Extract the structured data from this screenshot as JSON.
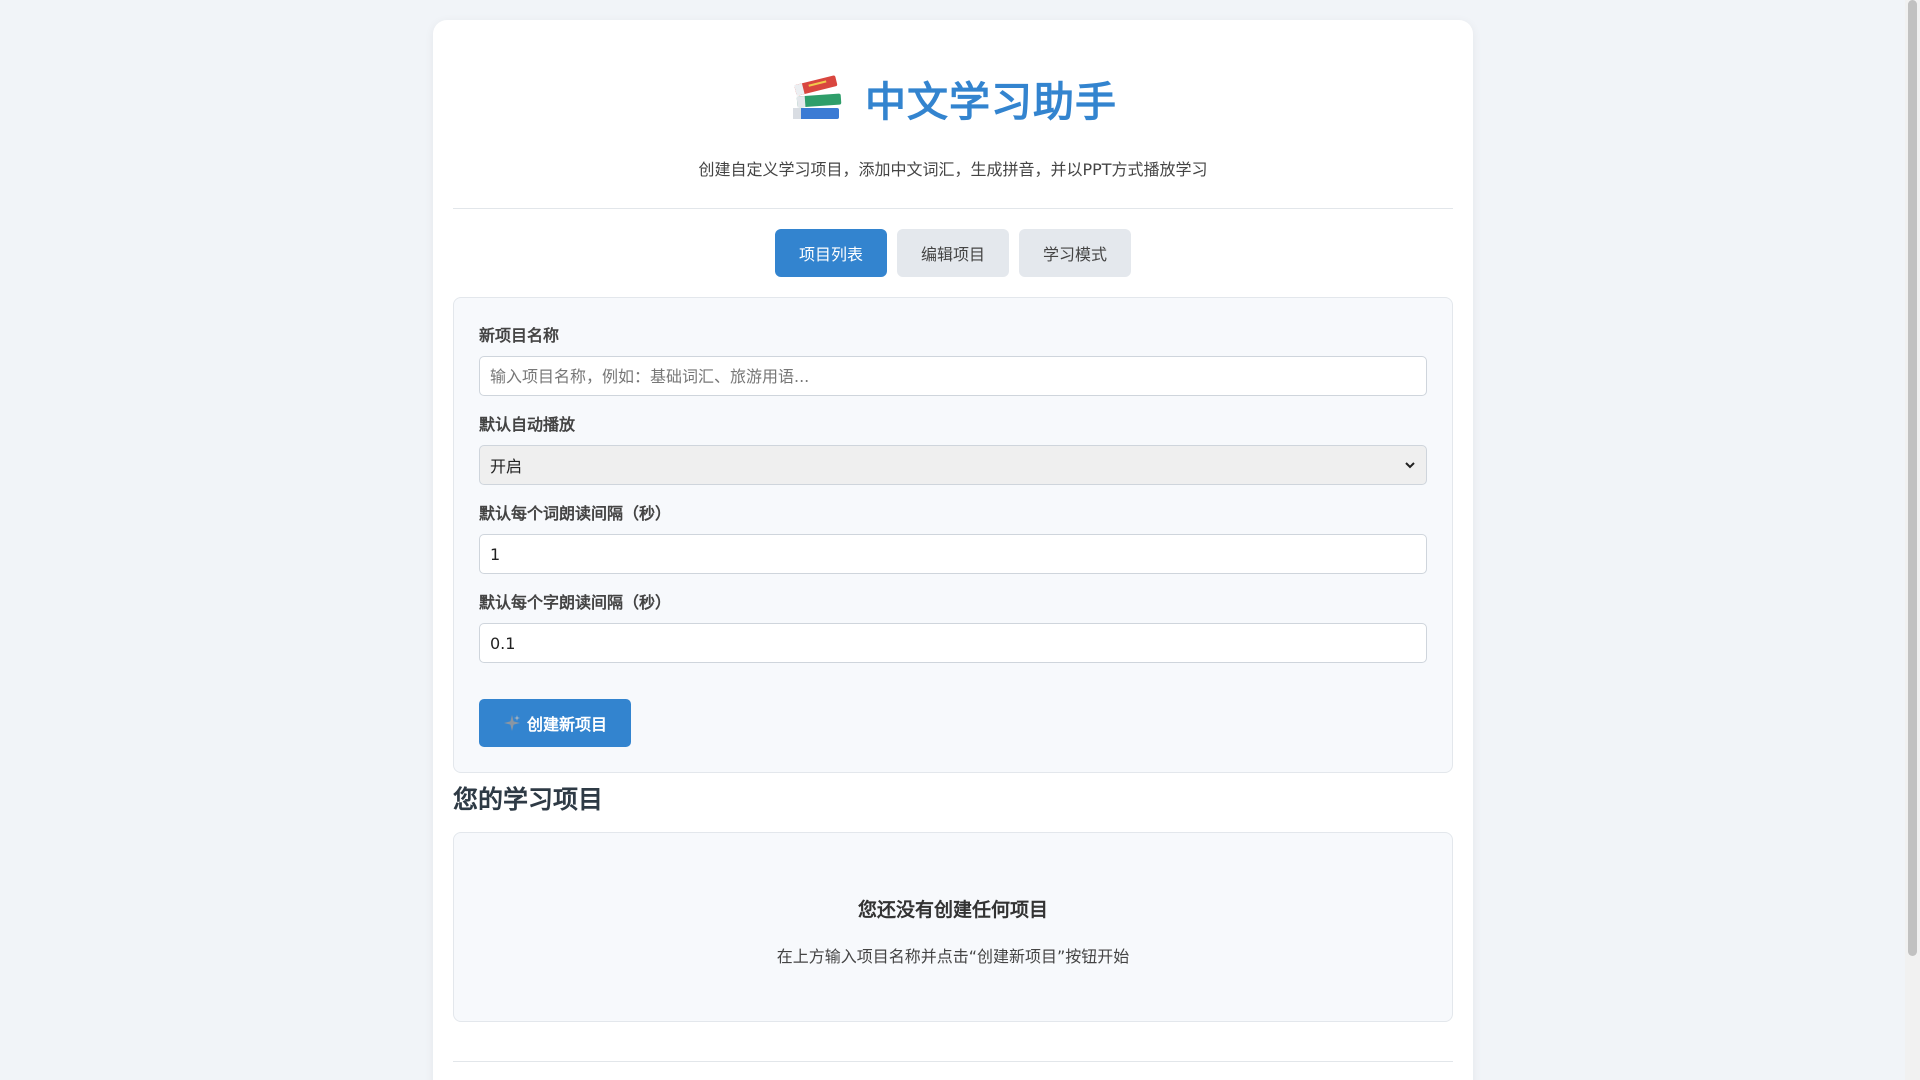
{
  "app": {
    "title": "中文学习助手",
    "subtitle": "创建自定义学习项目，添加中文词汇，生成拼音，并以PPT方式播放学习",
    "logo_icon": "books-icon"
  },
  "tabs": [
    {
      "label": "项目列表",
      "active": true
    },
    {
      "label": "编辑项目",
      "active": false
    },
    {
      "label": "学习模式",
      "active": false
    }
  ],
  "form": {
    "name_label": "新项目名称",
    "name_placeholder": "输入项目名称，例如：基础词汇、旅游用语...",
    "name_value": "",
    "autoplay_label": "默认自动播放",
    "autoplay_value": "开启",
    "word_interval_label": "默认每个词朗读间隔（秒）",
    "word_interval_value": "1",
    "char_interval_label": "默认每个字朗读间隔（秒）",
    "char_interval_value": "0.1",
    "create_button": "创建新项目",
    "create_button_icon": "sparkle-icon"
  },
  "projects": {
    "section_title": "您的学习项目",
    "empty_title": "您还没有创建任何项目",
    "empty_hint": "在上方输入项目名称并点击“创建新项目”按钮开始"
  },
  "colors": {
    "accent": "#3384cf",
    "background": "#f1f4f8",
    "panel": "#f7f9fc",
    "tab_inactive": "#e4e8ed"
  }
}
